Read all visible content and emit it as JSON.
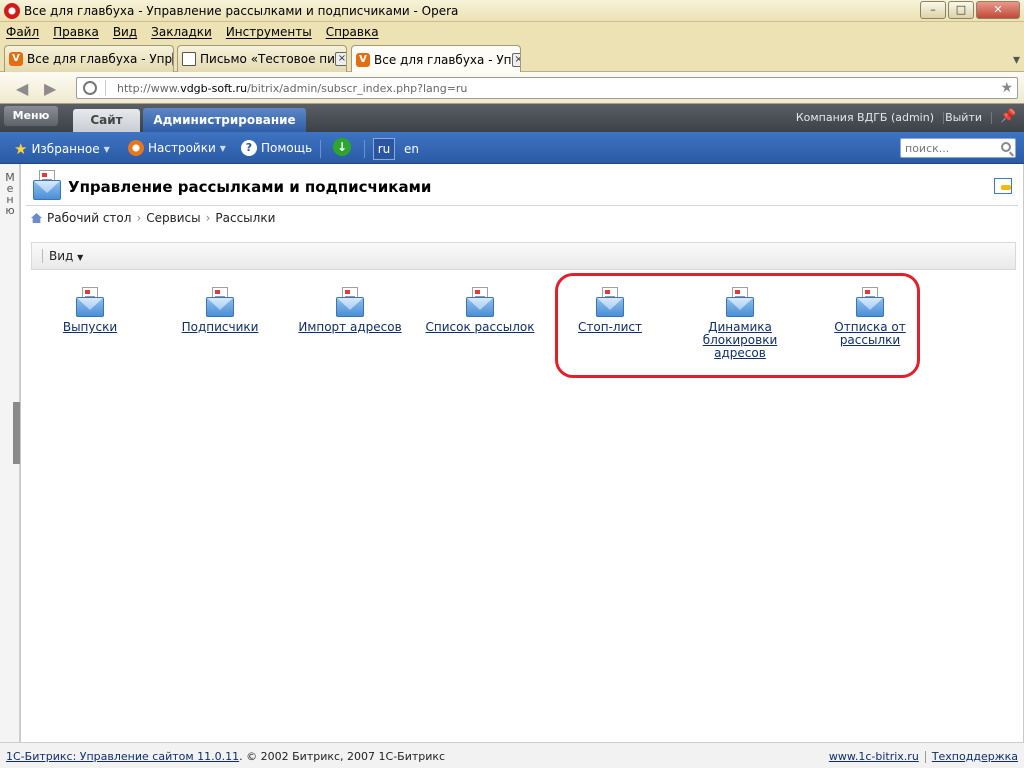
{
  "window": {
    "title": "Все для главбуха - Управление рассылками и подписчиками - Opera",
    "controls": {
      "minimize": "–",
      "maximize": "□",
      "close": "✕"
    }
  },
  "menubar": [
    "Файл",
    "Правка",
    "Вид",
    "Закладки",
    "Инструменты",
    "Справка"
  ],
  "tabs": [
    {
      "label": "Все для главбуха - Упр",
      "icon": "v-icon",
      "active": false
    },
    {
      "label": "Письмо «Тестовое пи",
      "icon": "mail-icon",
      "active": false
    },
    {
      "label": "Все для главбуха - Уп",
      "icon": "v-icon",
      "active": true
    }
  ],
  "address": {
    "prefix": "http://www.",
    "host": "vdgb-soft.ru",
    "path": "/bitrix/admin/subscr_index.php?lang=ru"
  },
  "panel": {
    "menu_label": "Меню",
    "site_tab": "Сайт",
    "admin_tab": "Администрирование",
    "user": "Компания ВДГБ (admin)",
    "logout": "Выйти"
  },
  "toolbar": {
    "favorites": "Избранное",
    "settings": "Настройки",
    "help": "Помощь",
    "lang_ru": "ru",
    "lang_en": "en",
    "search_placeholder": "поиск..."
  },
  "left_strip_label": "М е н ю",
  "page": {
    "title": "Управление рассылками и подписчиками",
    "breadcrumb": [
      "Рабочий стол",
      "Сервисы",
      "Рассылки"
    ],
    "view_button": "Вид"
  },
  "items": [
    {
      "label": "Выпуски"
    },
    {
      "label": "Подписчики"
    },
    {
      "label": "Импорт адресов"
    },
    {
      "label": "Список рассылок"
    },
    {
      "label": "Стоп-лист"
    },
    {
      "label": "Динамика блокировки адресов"
    },
    {
      "label": "Отписка от рассылки"
    }
  ],
  "footer": {
    "product_link": "1С-Битрикс: Управление сайтом 11.0.11",
    "copyright": ". © 2002 Битрикс, 2007 1С-Битрикс",
    "site_link": "www.1c-bitrix.ru",
    "support_link": "Техподдержка"
  }
}
